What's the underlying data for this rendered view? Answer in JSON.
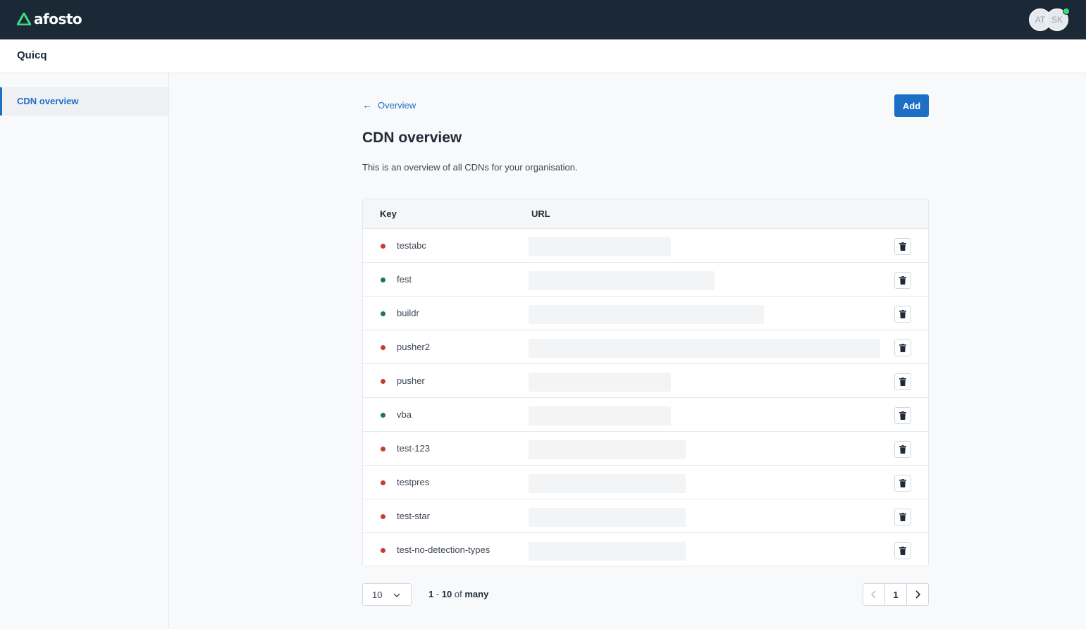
{
  "brand": {
    "name": "afosto",
    "accent": "#3ddc84"
  },
  "header": {
    "avatars": [
      {
        "initials": "AT"
      },
      {
        "initials": "SK"
      }
    ]
  },
  "app": {
    "title": "Quicq"
  },
  "sidebar": {
    "items": [
      {
        "label": "CDN overview",
        "active": true
      }
    ]
  },
  "main": {
    "back_label": "Overview",
    "add_label": "Add",
    "title": "CDN overview",
    "description": "This is an overview of all CDNs for your organisation."
  },
  "table": {
    "columns": [
      "Key",
      "URL"
    ],
    "rows": [
      {
        "key": "testabc",
        "status": "inactive"
      },
      {
        "key": "fest",
        "status": "active"
      },
      {
        "key": "buildr",
        "status": "active"
      },
      {
        "key": "pusher2",
        "status": "inactive"
      },
      {
        "key": "pusher",
        "status": "inactive"
      },
      {
        "key": "vba",
        "status": "active"
      },
      {
        "key": "test-123",
        "status": "inactive"
      },
      {
        "key": "testpres",
        "status": "inactive"
      },
      {
        "key": "test-star",
        "status": "inactive"
      },
      {
        "key": "test-no-detection-types",
        "status": "inactive"
      }
    ]
  },
  "status_colors": {
    "active": "#1e7a45",
    "inactive": "#c2412d"
  },
  "pagination": {
    "per_page": "10",
    "range_start": "1",
    "range_sep": " - ",
    "range_end": "10",
    "range_of": " of ",
    "range_total": "many",
    "current_page": "1"
  }
}
